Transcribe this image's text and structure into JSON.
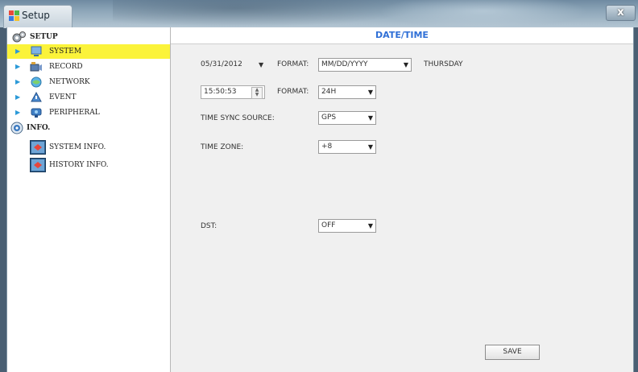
{
  "window": {
    "title": "Setup",
    "close_glyph": "x"
  },
  "sidebar": {
    "setup_label": "SETUP",
    "items": [
      {
        "label": "SYSTEM",
        "icon": "system-icon"
      },
      {
        "label": "RECORD",
        "icon": "record-icon"
      },
      {
        "label": "NETWORK",
        "icon": "network-icon"
      },
      {
        "label": "EVENT",
        "icon": "event-icon"
      },
      {
        "label": "PERIPHERAL",
        "icon": "peripheral-icon"
      }
    ],
    "info_label": "INFO.",
    "info_items": [
      {
        "label": "SYSTEM INFO.",
        "icon": "system-info-icon"
      },
      {
        "label": "HISTORY INFO.",
        "icon": "history-info-icon"
      }
    ],
    "selected": "SYSTEM",
    "highlight_color": "#fbf33a"
  },
  "page": {
    "title": "DATE/TIME",
    "title_color": "#2f6fd6",
    "date_value": "05/31/2012",
    "date_format_label": "FORMAT:",
    "date_format_value": "MM/DD/YYYY",
    "weekday": "THURSDAY",
    "time_value": "15:50:53",
    "time_format_label": "FORMAT:",
    "time_format_value": "24H",
    "sync_label": "TIME SYNC SOURCE:",
    "sync_value": "GPS",
    "zone_label": "TIME ZONE:",
    "zone_value": "+8",
    "dst_label": "DST:",
    "dst_value": "OFF",
    "save_label": "SAVE"
  }
}
